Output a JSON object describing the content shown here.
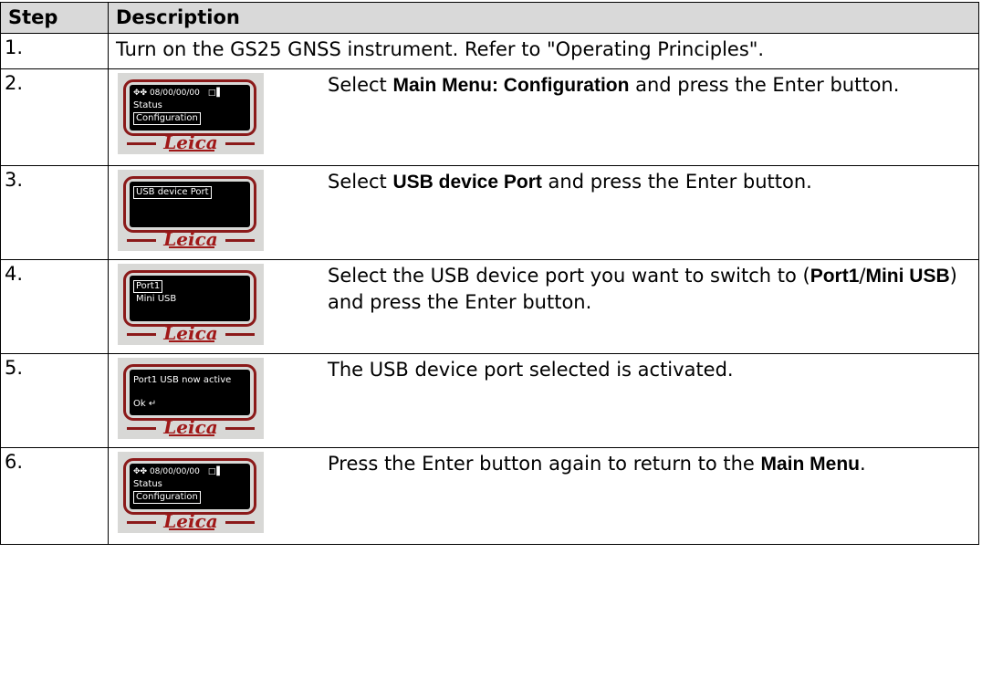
{
  "header": {
    "step": "Step",
    "description": "Description"
  },
  "rows": [
    {
      "step": "1.",
      "text": "Turn on the GS25 GNSS instrument. Refer to \"Operating Principles\"."
    },
    {
      "step": "2.",
      "display": {
        "status_icons": "✥✤ 08/00/00/00",
        "batt": "□▌",
        "lines": [
          "Status"
        ],
        "selected": "Configuration",
        "logo": "Leica"
      },
      "parts": [
        "Select ",
        "Main Menu: Configuration",
        " and press the Enter button."
      ]
    },
    {
      "step": "3.",
      "display": {
        "selected": "USB device Port",
        "logo": "Leica"
      },
      "parts": [
        "Select ",
        "USB device Port",
        " and press the Enter button."
      ]
    },
    {
      "step": "4.",
      "display": {
        "selected": "Port1",
        "lines": [
          "Mini USB"
        ],
        "logo": "Leica"
      },
      "parts": [
        "Select the USB device port you want to switch to (",
        "Port1",
        "/",
        "Mini USB",
        ") and press the Enter button."
      ]
    },
    {
      "step": "5.",
      "display": {
        "lines": [
          "Port1 USB now active",
          "Ok ↵"
        ],
        "logo": "Leica"
      },
      "parts": [
        "The USB device port selected is activated."
      ]
    },
    {
      "step": "6.",
      "display": {
        "status_icons": "✥✤ 08/00/00/00",
        "batt": "□▌",
        "lines": [
          "Status"
        ],
        "selected": "Configuration",
        "logo": "Leica"
      },
      "parts": [
        "Press the Enter button again to return to the ",
        "Main Menu",
        "."
      ]
    }
  ]
}
